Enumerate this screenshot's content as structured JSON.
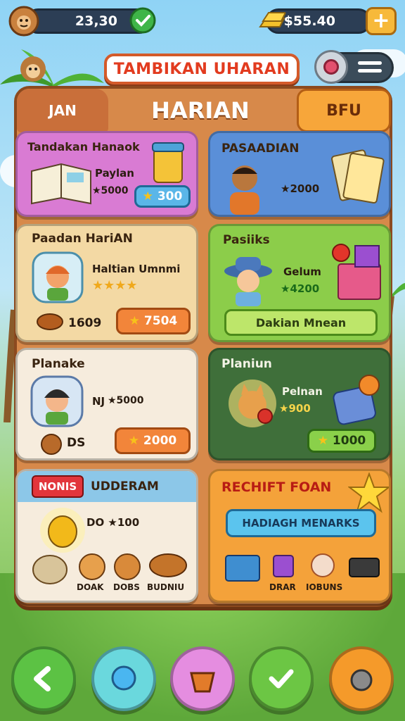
{
  "topbar": {
    "coins": "23,30",
    "money": "$55.40"
  },
  "header": {
    "banner": "TAMBIKAN UHARAN"
  },
  "tabs": {
    "left": "JAN",
    "center": "HARIAN",
    "right": "BFU"
  },
  "cards": [
    {
      "title": "Tandakan Hanaok",
      "sub": "Paylan",
      "reward": "★5000",
      "button": "300"
    },
    {
      "title": "PASAADIAN",
      "reward": "★2000"
    },
    {
      "title": "Paadan HariAN",
      "sub": "Haltian Umnmi",
      "stars": "★★★★",
      "count": "1609",
      "button": "7504"
    },
    {
      "title": "Pasiiks",
      "sub": "Gelum",
      "reward": "★4200",
      "button": "Dakian Mnean"
    },
    {
      "title": "Planake",
      "sub": "NJ",
      "reward": "★5000",
      "count": "DS",
      "button": "2000"
    },
    {
      "title": "Planiun",
      "sub": "Pelnan",
      "reward": "★900",
      "button": "1000"
    },
    {
      "title": "UDDERAM",
      "tag": "NONIS",
      "reward": "DO ★100",
      "labels": [
        "DOAK",
        "DOBS",
        "BUDNIU"
      ]
    },
    {
      "title": "RECHIFT FOAN",
      "banner": "HADIAGH MENARKS",
      "labels": [
        "DRAR",
        "IOBUNS"
      ]
    }
  ],
  "icons": {
    "coin": "monkey-coin-icon",
    "check": "check-icon",
    "gold": "gold-bar-icon",
    "plus": "plus-icon",
    "gear": "gear-icon",
    "menu": "menu-icon"
  },
  "nav": [
    "back-icon",
    "bubble-icon",
    "basket-icon",
    "confirm-icon",
    "pet-icon"
  ]
}
